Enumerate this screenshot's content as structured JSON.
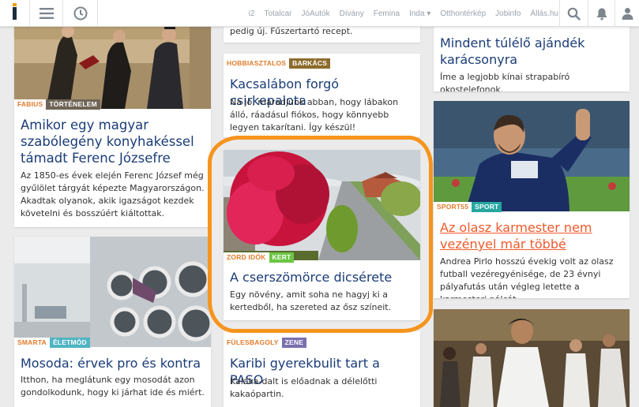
{
  "topbar": {
    "links": [
      "i2",
      "Totalcar",
      "JóAutók",
      "Dívány",
      "Femina",
      "Inda ▾",
      "Otthontérkép",
      "Jobinfo",
      "Állás.hu"
    ]
  },
  "colors": {
    "accent": "#f7941d",
    "title": "#1a3c78",
    "link_orange": "#ef5a2c"
  },
  "cards": {
    "c1": {
      "tag": "FABIUS",
      "sub": "TÖRTÉNELEM",
      "sub_color": "#6f6457",
      "title": "Amikor egy magyar szabólegény konyhakéssel támadt Ferenc Józsefre",
      "desc": "Az 1850-es évek elején Ferenc József még gyűlölet tárgyát képezte Magyarországon. Akadtak olyanok, akik igazságot kezdek követelni és bosszúért kiáltottak."
    },
    "c2": {
      "tag": "SMARTA",
      "sub": "ÉLETMÓD",
      "sub_color": "#4fb4c2",
      "title": "Mosoda: érvek pro és kontra",
      "desc": "Itthon, ha meglátunk egy mosodát azon gondolkodunk, hogy ki járhat ide és miért."
    },
    "c3": {
      "desc": "pedig új. Fűszertartó recept."
    },
    "c4": {
      "tag": "HOBBIASZTALOS",
      "sub": "BARKÁCS",
      "sub_color": "#8c6b2c",
      "title": "Kacsalábon forgó csirkepalota",
      "desc": "Na jó, maradjunk abban, hogy lábakon álló, ráadásul fiókos, hogy könnyebb legyen takarítani. Így készül!"
    },
    "c5": {
      "tag": "ZORD IDŐK",
      "sub": "KERT",
      "sub_color": "#6cc644",
      "title": "A cserszömörce dicsérete",
      "desc": "Egy növény, amit soha ne hagyj ki a kertedből, ha szereted az ősz színeit."
    },
    "c6": {
      "tag": "FÜLESBAGOLY",
      "sub": "ZENE",
      "sub_color": "#7a6fb0",
      "title": "Karibi gyerekbulit tart a PASO",
      "desc": "Kaláka-dalt is előadnak a délelőtti kakaópartin."
    },
    "c7": {
      "title": "Mindent túlélő ajándék karácsonyra",
      "desc": "Íme a legjobb kínai strapabíró okostelefonok."
    },
    "c8": {
      "tag": "SPORT55",
      "sub": "SPORT",
      "sub_color": "#27a7a0",
      "title": "Az olasz karmester nem vezényel már többé",
      "desc": "Andrea Pirlo hosszú évekig volt az olasz futball vezéregyénisége, de 23 évnyi pályafutás után végleg letette a karmesteri pálcát."
    }
  }
}
